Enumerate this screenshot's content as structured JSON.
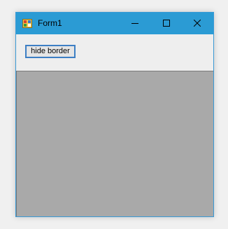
{
  "window": {
    "title": "Form1",
    "app_icon": "winforms-app-icon",
    "caption_buttons": [
      {
        "name": "minimize",
        "icon": "minimize-icon"
      },
      {
        "name": "maximize",
        "icon": "maximize-icon"
      },
      {
        "name": "close",
        "icon": "close-icon"
      }
    ]
  },
  "toolbar": {
    "hide_border_label": "hide border"
  },
  "colors": {
    "titlebar": "#2b9bd4",
    "client_background": "#eeeeee",
    "panel_background": "#a9a9a9",
    "button_focus_border": "#3d7fc4"
  }
}
